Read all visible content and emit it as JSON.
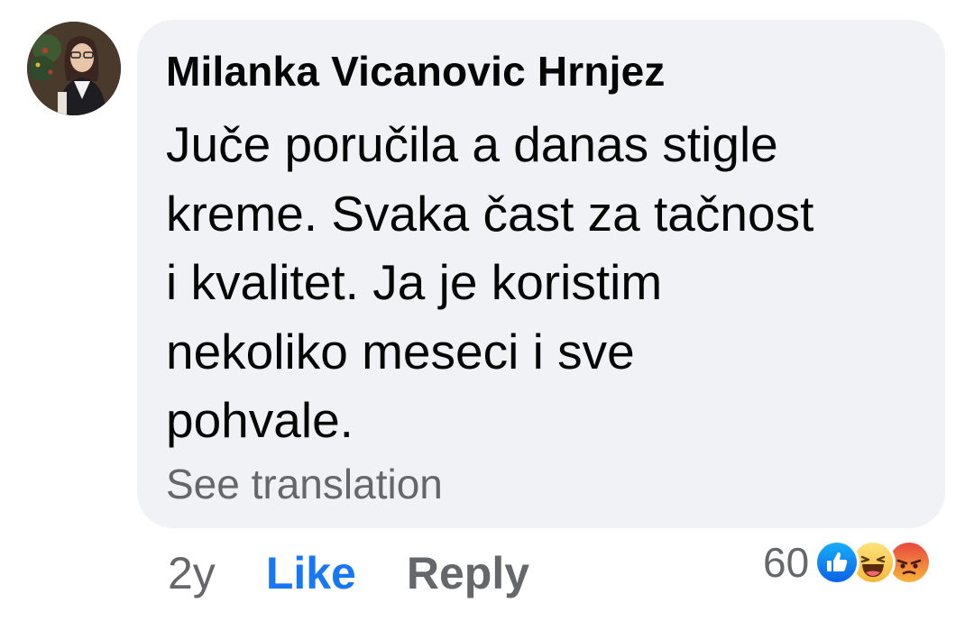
{
  "comment": {
    "author": "Milanka Vicanovic Hrnjez",
    "text": "Juče poručila a danas stigle\nkreme. Svaka čast za tačnost\ni kvalitet. Ja je koristim\nnekoliko meseci  i sve\npohvale.",
    "see_translation": "See translation",
    "time": "2y",
    "like_label": "Like",
    "reply_label": "Reply",
    "reaction_count": "60",
    "reactions": [
      "like-icon",
      "haha-icon",
      "angry-icon"
    ]
  },
  "colors": {
    "bubble": "#f0f2f5",
    "like_blue": "#1877f2",
    "secondary_text": "#65676b",
    "primary_text": "#050505"
  }
}
